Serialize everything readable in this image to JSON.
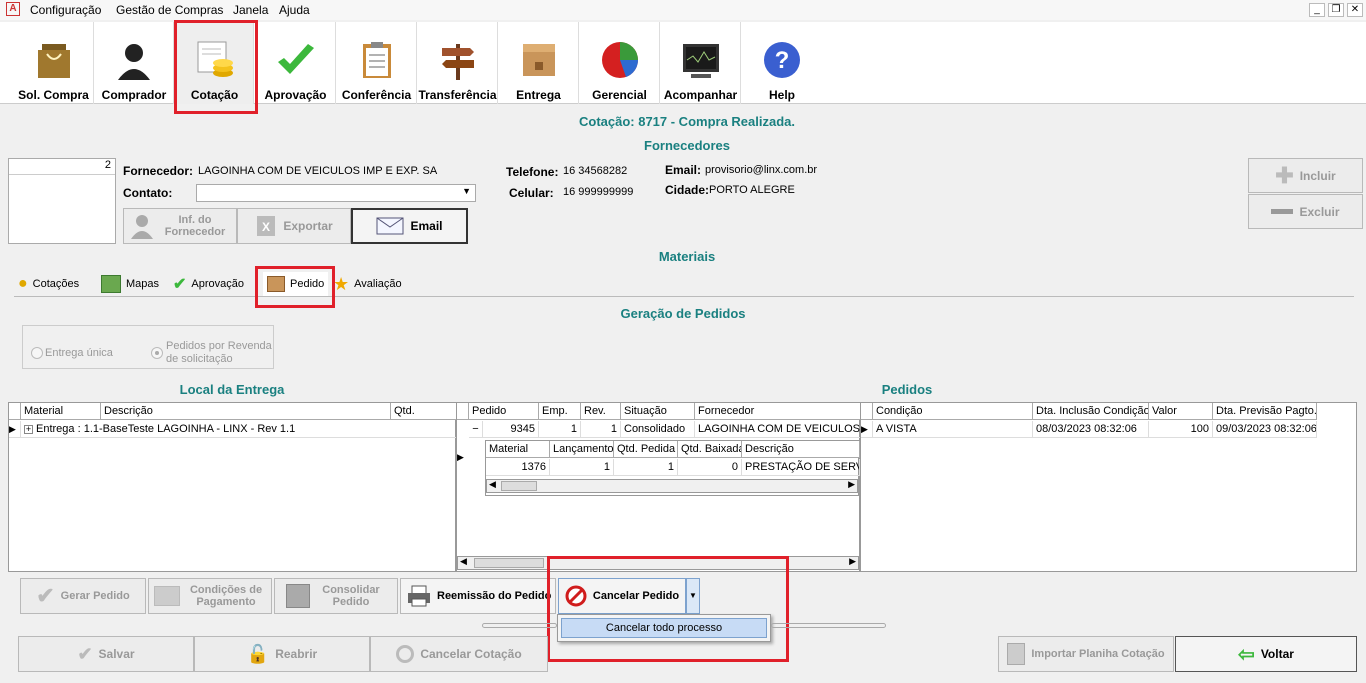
{
  "menu": {
    "items": [
      "Configuração",
      "Gestão de Compras",
      "Janela",
      "Ajuda"
    ]
  },
  "toolbar": {
    "items": [
      {
        "label": "Sol. Compra",
        "icon": "shopping-bag-icon"
      },
      {
        "label": "Comprador",
        "icon": "person-icon"
      },
      {
        "label": "Cotação",
        "icon": "coins-icon"
      },
      {
        "label": "Aprovação",
        "icon": "checkmark-icon"
      },
      {
        "label": "Conferência",
        "icon": "clipboard-icon"
      },
      {
        "label": "Transferência",
        "icon": "signpost-icon"
      },
      {
        "label": "Entrega",
        "icon": "box-icon"
      },
      {
        "label": "Gerencial",
        "icon": "pie-chart-icon"
      },
      {
        "label": "Acompanhar",
        "icon": "monitor-icon"
      },
      {
        "label": "Help",
        "icon": "help-icon"
      }
    ]
  },
  "header": {
    "title": "Cotação: 8717 - Compra Realizada.",
    "section": "Fornecedores"
  },
  "supplier": {
    "count": "2",
    "fornecedor_label": "Fornecedor:",
    "fornecedor": "LAGOINHA COM DE VEICULOS IMP E EXP. SA",
    "contato_label": "Contato:",
    "contato": "",
    "telefone_label": "Telefone:",
    "telefone": "16   34568282",
    "celular_label": "Celular:",
    "celular": "16  999999999",
    "email_label": "Email:",
    "email": "provisorio@linx.com.br",
    "cidade_label": "Cidade:",
    "cidade": "PORTO ALEGRE",
    "btn_info": "Inf. do Fornecedor",
    "btn_export": "Exportar",
    "btn_email": "Email",
    "btn_incluir": "Incluir",
    "btn_excluir": "Excluir"
  },
  "materiais": {
    "title": "Materiais",
    "tabs": [
      "Cotações",
      "Mapas",
      "Aprovação",
      "Pedido",
      "Avaliação"
    ]
  },
  "geracao": {
    "title": "Geração de Pedidos",
    "opt1": "Entrega única",
    "opt2": "Pedidos por Revenda de solicitação"
  },
  "local": {
    "title": "Local da Entrega",
    "headers": [
      "Material",
      "Descrição",
      "Qtd."
    ],
    "row": "Entrega : 1.1-BaseTeste LAGOINHA - LINX - Rev 1.1"
  },
  "pedidos_title": "Pedidos",
  "pedido_grid": {
    "headers": [
      "Pedido",
      "Emp.",
      "Rev.",
      "Situação",
      "Fornecedor"
    ],
    "row": [
      "9345",
      "1",
      "1",
      "Consolidado",
      "LAGOINHA COM DE VEICULOS IMP"
    ],
    "sub_headers": [
      "Material",
      "Lançamento",
      "Qtd. Pedida",
      "Qtd. Baixada",
      "Descrição"
    ],
    "sub_row": [
      "1376",
      "1",
      "1",
      "0",
      "PRESTAÇÃO DE SERVIÇ"
    ]
  },
  "cond_grid": {
    "headers": [
      "Condição",
      "Dta. Inclusão Condição",
      "Valor",
      "Dta. Previsão Pagto."
    ],
    "row": [
      "A VISTA",
      "08/03/2023 08:32:06",
      "100",
      "09/03/2023 08:32:06"
    ]
  },
  "actions": {
    "gerar": "Gerar Pedido",
    "condicoes": "Condições de Pagamento",
    "consolidar": "Consolidar Pedido",
    "reemissao": "Reemissão do Pedido",
    "cancelar": "Cancelar Pedido",
    "cancelar_todo": "Cancelar todo processo"
  },
  "footer": {
    "salvar": "Salvar",
    "reabrir": "Reabrir",
    "cancelar_cot": "Cancelar Cotação",
    "importar": "Importar Planiha Cotação",
    "voltar": "Voltar"
  }
}
